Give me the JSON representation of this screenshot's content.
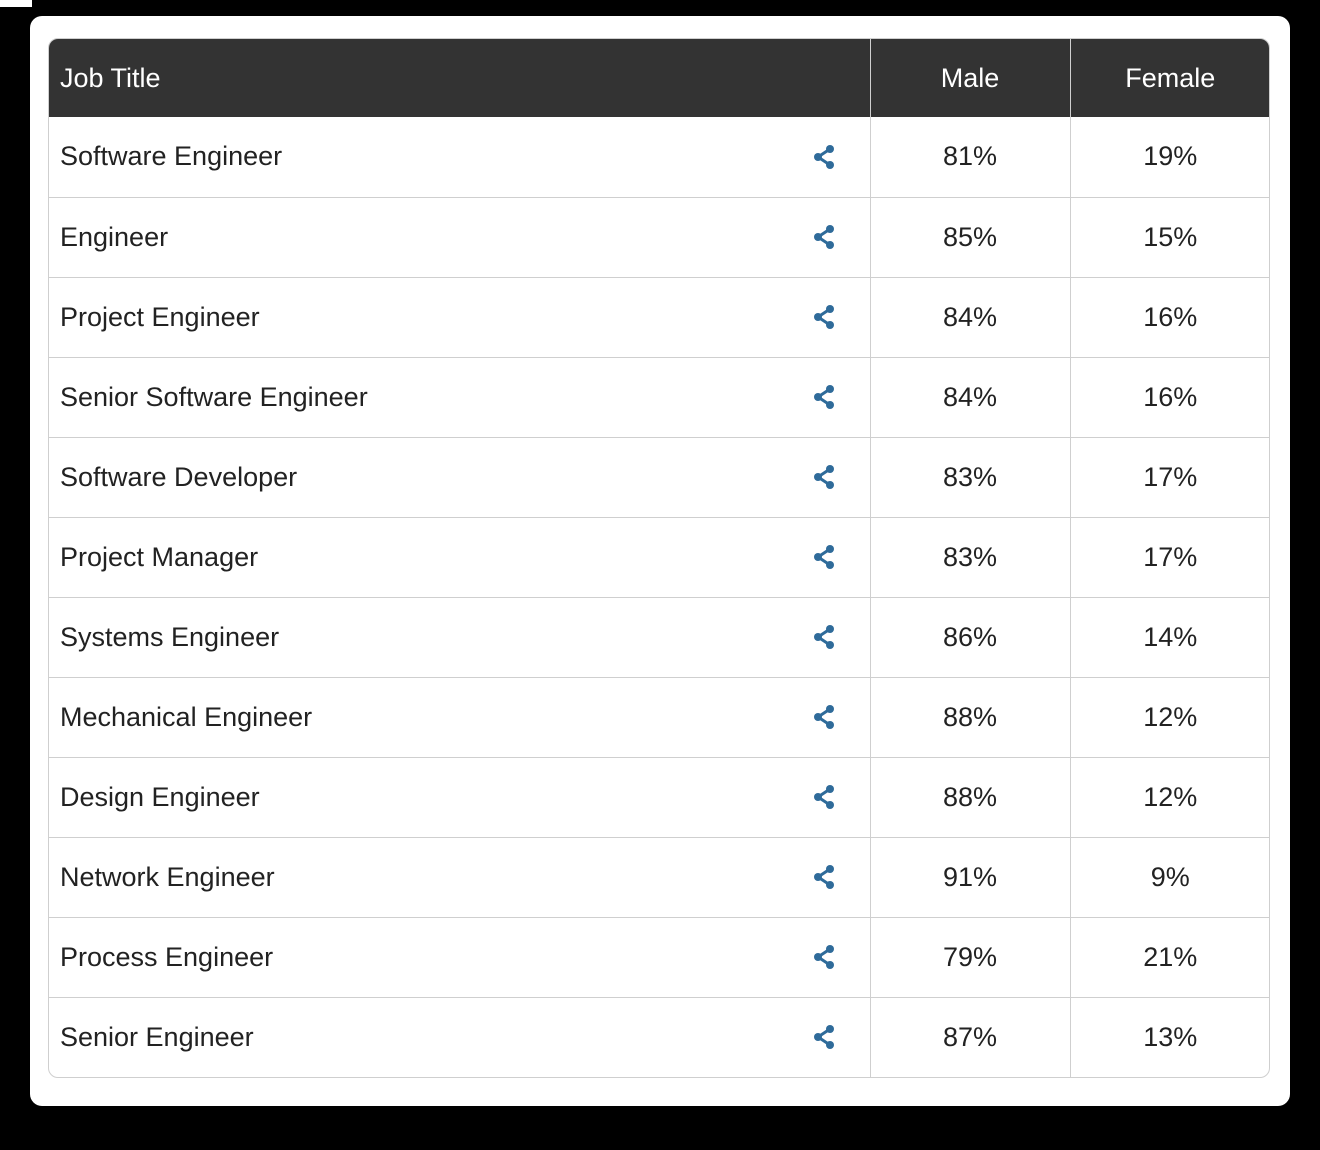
{
  "table": {
    "headers": {
      "job_title": "Job Title",
      "male": "Male",
      "female": "Female"
    },
    "rows": [
      {
        "title": "Software Engineer",
        "male": "81%",
        "female": "19%"
      },
      {
        "title": "Engineer",
        "male": "85%",
        "female": "15%"
      },
      {
        "title": "Project Engineer",
        "male": "84%",
        "female": "16%"
      },
      {
        "title": "Senior Software Engineer",
        "male": "84%",
        "female": "16%"
      },
      {
        "title": "Software Developer",
        "male": "83%",
        "female": "17%"
      },
      {
        "title": "Project Manager",
        "male": "83%",
        "female": "17%"
      },
      {
        "title": "Systems Engineer",
        "male": "86%",
        "female": "14%"
      },
      {
        "title": "Mechanical Engineer",
        "male": "88%",
        "female": "12%"
      },
      {
        "title": "Design Engineer",
        "male": "88%",
        "female": "12%"
      },
      {
        "title": "Network Engineer",
        "male": "91%",
        "female": "9%"
      },
      {
        "title": "Process Engineer",
        "male": "79%",
        "female": "21%"
      },
      {
        "title": "Senior Engineer",
        "male": "87%",
        "female": "13%"
      }
    ],
    "row_icon": "share-icon"
  },
  "colors": {
    "header_bg": "#333333",
    "header_text": "#ffffff",
    "icon": "#2f6b9a",
    "border": "#cfcfcf",
    "page_bg": "#000000",
    "card_bg": "#ffffff"
  }
}
